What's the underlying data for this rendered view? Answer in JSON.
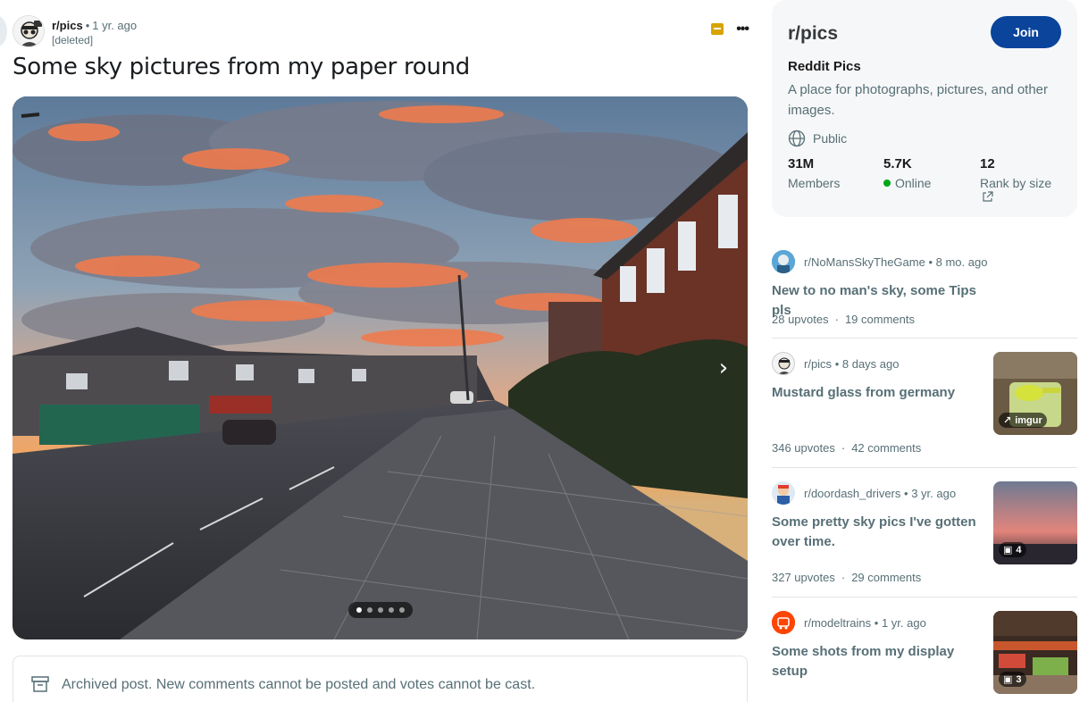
{
  "post": {
    "subreddit": "r/pics",
    "separator": "•",
    "time": "1 yr. ago",
    "author": "[deleted]",
    "more_label": "•••",
    "title": "Some sky pictures from my paper round",
    "gallery": {
      "current_index": 1,
      "total": 5,
      "next_icon": "chevron-right-icon"
    },
    "archived_notice": "Archived post. New comments cannot be posted and votes cannot be cast."
  },
  "about": {
    "title": "r/pics",
    "join_label": "Join",
    "name": "Reddit Pics",
    "description": "A place for photographs, pictures, and other images.",
    "visibility": "Public",
    "stats": [
      {
        "value": "31M",
        "label": "Members"
      },
      {
        "value": "5.7K",
        "label": "Online"
      },
      {
        "value": "12",
        "label": "Rank by size"
      }
    ],
    "colors": {
      "join": "#0a449b",
      "online": "#01a816"
    }
  },
  "related": [
    {
      "subreddit": "r/NoMansSkyTheGame",
      "time": "8 mo. ago",
      "title": "New to no man's sky, some Tips pls",
      "upvotes": "28 upvotes",
      "comments": "19 comments"
    },
    {
      "subreddit": "r/pics",
      "time": "8 days ago",
      "title": "Mustard glass from germany",
      "upvotes": "346 upvotes",
      "comments": "42 comments",
      "thumb_badge": "imgur"
    },
    {
      "subreddit": "r/doordash_drivers",
      "time": "3 yr. ago",
      "title": "Some pretty sky pics I've gotten over time.",
      "upvotes": "327 upvotes",
      "comments": "29 comments",
      "thumb_badge": "4"
    },
    {
      "subreddit": "r/modeltrains",
      "time": "1 yr. ago",
      "title": "Some shots from my display setup",
      "thumb_badge": "3"
    }
  ],
  "middle_dot": "·"
}
